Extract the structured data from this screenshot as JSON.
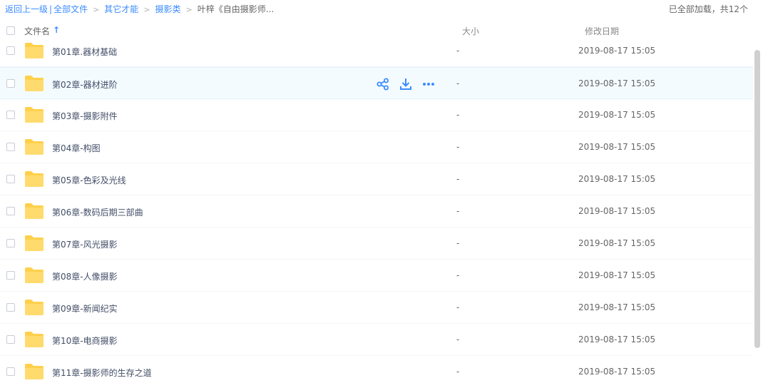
{
  "breadcrumb": {
    "back": "返回上一级",
    "divider": "|",
    "items": [
      "全部文件",
      "其它才能",
      "摄影类"
    ],
    "separator": ">",
    "current": "叶梓《自由摄影师..."
  },
  "status": "已全部加载，共12个",
  "columns": {
    "name": "文件名",
    "sort_indicator": "↑",
    "size": "大小",
    "date": "修改日期"
  },
  "files": [
    {
      "name": "第01章.器材基础",
      "size": "-",
      "date": "2019-08-17 15:05"
    },
    {
      "name": "第02章-器材进阶",
      "size": "-",
      "date": "2019-08-17 15:05"
    },
    {
      "name": "第03章-摄影附件",
      "size": "-",
      "date": "2019-08-17 15:05"
    },
    {
      "name": "第04章-构图",
      "size": "-",
      "date": "2019-08-17 15:05"
    },
    {
      "name": "第05章-色彩及光线",
      "size": "-",
      "date": "2019-08-17 15:05"
    },
    {
      "name": "第06章-数码后期三部曲",
      "size": "-",
      "date": "2019-08-17 15:05"
    },
    {
      "name": "第07章-风光摄影",
      "size": "-",
      "date": "2019-08-17 15:05"
    },
    {
      "name": "第08章-人像摄影",
      "size": "-",
      "date": "2019-08-17 15:05"
    },
    {
      "name": "第09章-新闻纪实",
      "size": "-",
      "date": "2019-08-17 15:05"
    },
    {
      "name": "第10章-电商摄影",
      "size": "-",
      "date": "2019-08-17 15:05"
    },
    {
      "name": "第11章-摄影师的生存之道",
      "size": "-",
      "date": "2019-08-17 15:05"
    }
  ],
  "hover_row_index": 1,
  "row_actions": [
    "share-icon",
    "download-icon",
    "more-icon"
  ],
  "colors": {
    "accent": "#3b8cff",
    "folder": "#ffd04b",
    "hover_bg": "#f4fbff"
  }
}
